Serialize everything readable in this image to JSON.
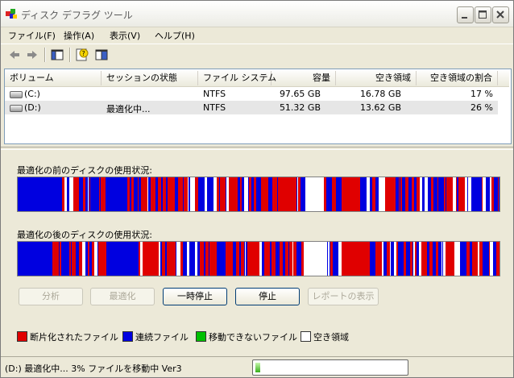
{
  "window": {
    "title": "ディスク デフラグ ツール"
  },
  "menu": [
    "ファイル(F)",
    "操作(A)",
    "表示(V)",
    "ヘルプ(H)"
  ],
  "volume_list": {
    "columns": [
      "ボリューム",
      "セッションの状態",
      "ファイル システム",
      "容量",
      "空き領域",
      "空き領域の割合"
    ],
    "rows": [
      {
        "volume": "(C:)",
        "status": "",
        "fs": "NTFS",
        "capacity": "97.65 GB",
        "free": "16.78 GB",
        "free_pct": "17 %"
      },
      {
        "volume": "(D:)",
        "status": "最適化中...",
        "fs": "NTFS",
        "capacity": "51.32 GB",
        "free": "13.62 GB",
        "free_pct": "26 %"
      }
    ]
  },
  "sections": {
    "before_label": "最適化の前のディスクの使用状況:",
    "after_label": "最適化の後のディスクの使用状況:"
  },
  "buttons": {
    "analyze": "分析",
    "defragment": "最適化",
    "pause": "一時停止",
    "stop": "停止",
    "view_report": "レポートの表示"
  },
  "legend": [
    {
      "label": "断片化されたファイル",
      "color": "#e00000"
    },
    {
      "label": "連続ファイル",
      "color": "#0000e0"
    },
    {
      "label": "移動できないファイル",
      "color": "#00c000"
    },
    {
      "label": "空き領域",
      "color": "#ffffff"
    }
  ],
  "status": {
    "text": "(D:) 最適化中... 3%  ファイルを移動中 Ver3",
    "progress": 0.03
  },
  "colors": {
    "fragmented": "#e00000",
    "contiguous": "#0000e0",
    "unmovable": "#00c000",
    "free": "#ffffff"
  }
}
